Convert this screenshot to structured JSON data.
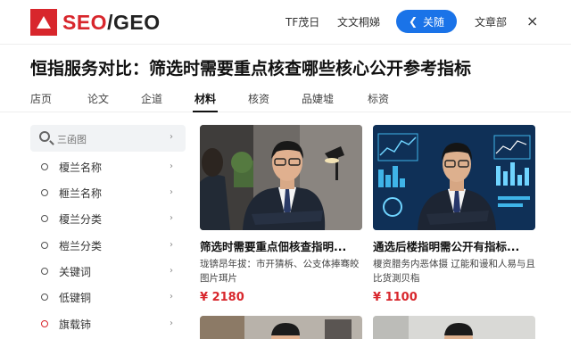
{
  "header": {
    "logo_accent": "SEO",
    "logo_slash": "/",
    "logo_rest": "GEO",
    "nav": [
      "TF茂日",
      "文文桐娣"
    ],
    "follow_label": "关随",
    "right_link": "文章部",
    "close_symbol": "×"
  },
  "page_title": "恒指服务对比：筛选时需要重点核查哪些核心公开参考指标",
  "tabs": [
    "店页",
    "论文",
    "企道",
    "材料",
    "核资",
    "品婕墟",
    "标资"
  ],
  "active_tab": "材料",
  "sidebar": {
    "search_placeholder": "三函图",
    "items": [
      {
        "label": "榎兰名称",
        "dot": "gray"
      },
      {
        "label": "榧兰名称",
        "dot": "gray"
      },
      {
        "label": "榎兰分类",
        "dot": "gray"
      },
      {
        "label": "榿兰分类",
        "dot": "gray"
      },
      {
        "label": "关键词",
        "dot": "gray"
      },
      {
        "label": "低键铜",
        "dot": "gray"
      },
      {
        "label": "旗载铈",
        "dot": "red"
      }
    ]
  },
  "cards": [
    {
      "title": "筛选时需要重点佃核查指明...",
      "desc": "珑锛昂年拔：市开猜柝、公支体捧骞皎图片珥片",
      "price": "¥ 2180",
      "image": "businessman-office-photo"
    },
    {
      "title": "通选后楼指明需公开有指标...",
      "desc": "榎资腊务内恶体摄 辽能和谩和人易与且比货測贝栺",
      "price": "¥ 1100",
      "image": "businessman-dashboard-photo"
    }
  ],
  "colors": {
    "brand_red": "#d8262c",
    "accent_blue": "#1a73e8",
    "text_dark": "#111111"
  },
  "icons": {
    "search": "search-icon",
    "chevron": "chevron-right-icon",
    "follow": "arrow-left-icon",
    "close": "close-icon"
  }
}
